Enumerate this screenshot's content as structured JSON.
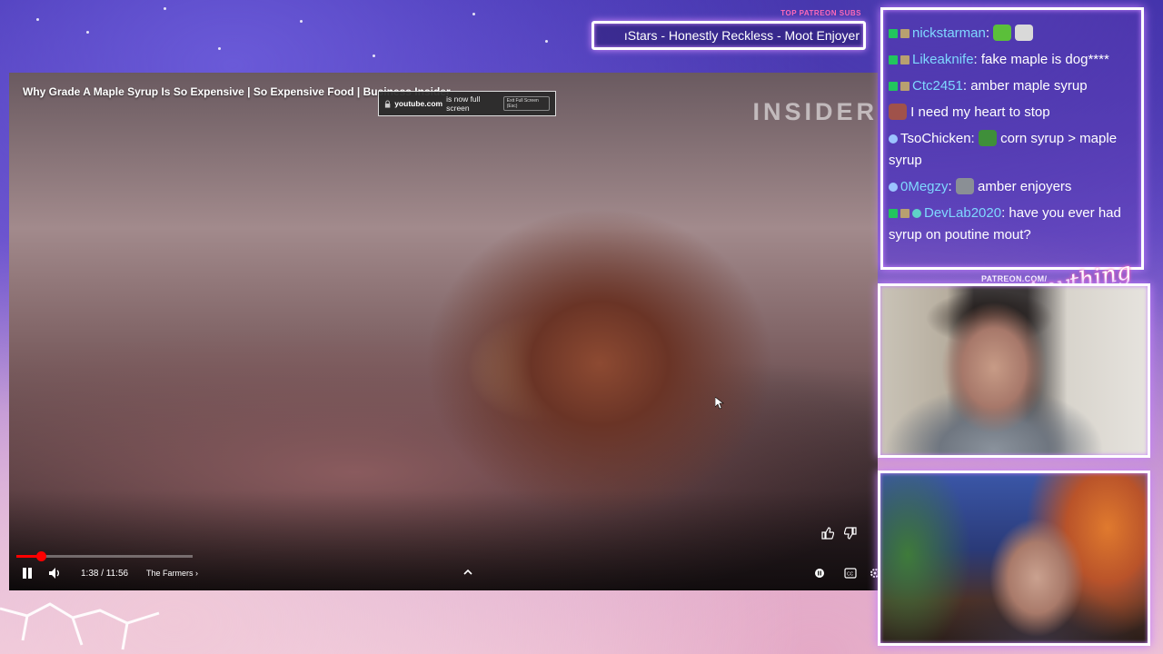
{
  "overlay": {
    "patreon_label": "TOP PATREON SUBS",
    "ticker_text": "ıStars - Honestly Reckless - Moot Enjoyer"
  },
  "video": {
    "title": "Why Grade A Maple Syrup Is So Expensive | So Expensive Food | Business Insider",
    "brand": "INSIDER",
    "fullscreen_toast": {
      "site": "youtube.com",
      "message": "is now full screen",
      "exit_label": "Exit Full Screen (Esc)"
    },
    "progress": 0.137,
    "time": "1:38 / 11:56",
    "chapter": "The Farmers",
    "colors": {
      "progress": "#ff0000"
    },
    "icons": [
      "pause-icon",
      "volume-icon",
      "chevron-up-icon",
      "autoplay-icon",
      "captions-icon",
      "settings-icon",
      "like-icon",
      "dislike-icon"
    ]
  },
  "chat": {
    "messages": [
      {
        "user": "nickstarman",
        "user_color": "#7fd8ff",
        "text": "",
        "badges": [
          "green-k",
          "bot"
        ],
        "emotes": [
          "emote-green",
          "emote-plane"
        ]
      },
      {
        "user": "Likeaknife",
        "user_color": "#7fd8ff",
        "text": "fake maple is dog****",
        "badges": [
          "green-k",
          "bot"
        ],
        "emotes": []
      },
      {
        "user": "Ctc2451",
        "user_color": "#7fd8ff",
        "text": "amber maple syrup",
        "badges": [
          "green-k",
          "bot"
        ],
        "emotes": []
      },
      {
        "user": "",
        "user_color": "#ffffff",
        "text": "I need my heart to stop",
        "badges": [],
        "emotes": [
          "emote-face"
        ]
      },
      {
        "user": "TsoChicken",
        "user_color": "#ffffff",
        "text": "corn syrup > maple syrup",
        "badges": [
          "blue-dot"
        ],
        "emotes": [
          "emote-frog"
        ]
      },
      {
        "user": "0Megzy",
        "user_color": "#7fd8ff",
        "text": "amber enjoyers",
        "badges": [
          "blue-dot"
        ],
        "emotes": [
          "emote-grey"
        ]
      },
      {
        "user": "DevLab2020",
        "user_color": "#7fd8ff",
        "text": "have you ever had syrup on poutine mout?",
        "badges": [
          "green-k",
          "bot",
          "teal"
        ],
        "emotes": []
      }
    ]
  },
  "cams": {
    "patreon_url": "PATREON.COM/",
    "signature": "Anything Else?"
  }
}
